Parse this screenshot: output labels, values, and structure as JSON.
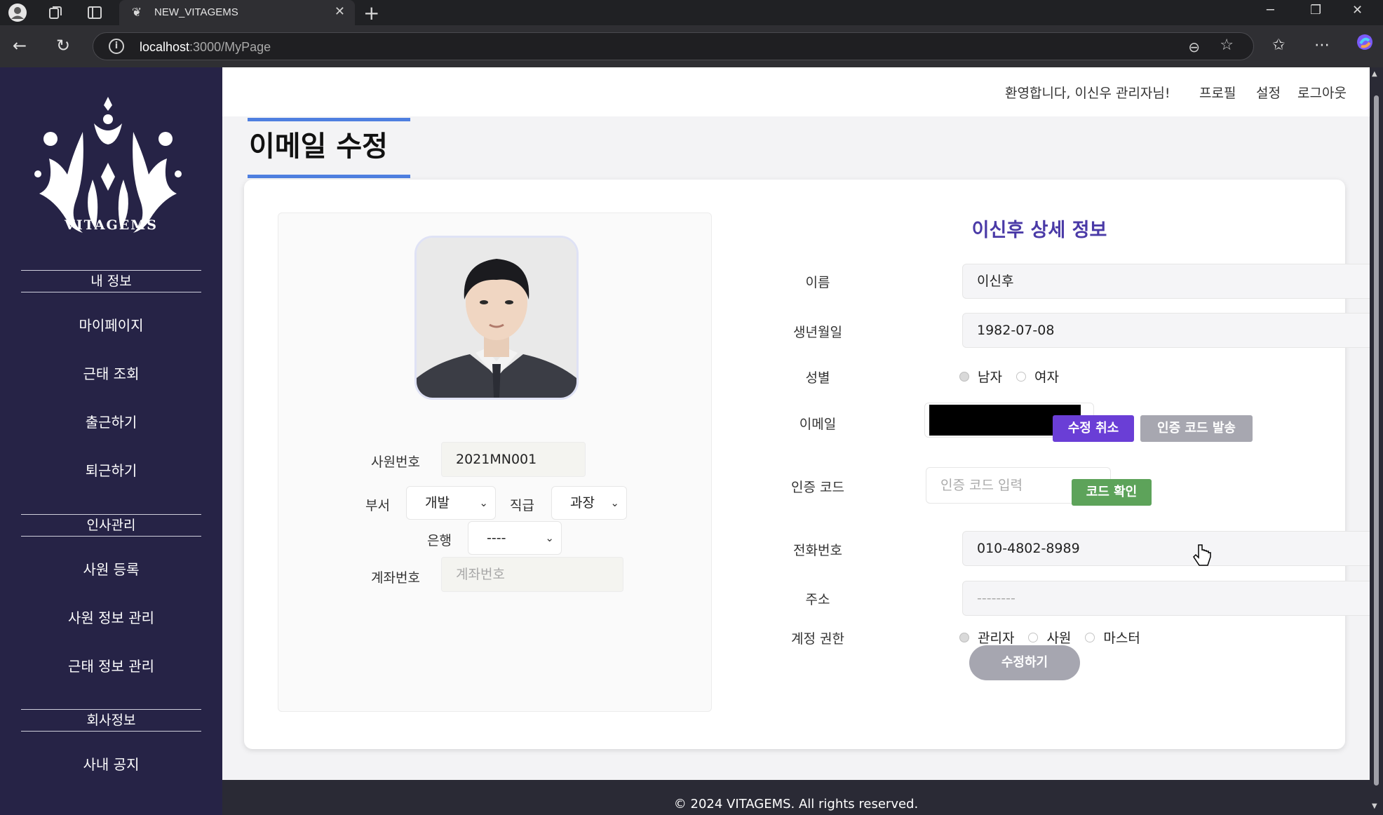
{
  "browser": {
    "tab_title": "NEW_VITAGEMS",
    "url_host": "localhost",
    "url_path": ":3000/MyPage"
  },
  "sidebar": {
    "logo_text": "VITAGEMS",
    "sections": [
      {
        "title": "내 정보",
        "items": [
          "마이페이지",
          "근태 조회",
          "출근하기",
          "퇴근하기"
        ]
      },
      {
        "title": "인사관리",
        "items": [
          "사원 등록",
          "사원 정보 관리",
          "근태 정보 관리"
        ]
      },
      {
        "title": "회사정보",
        "items": [
          "사내 공지"
        ]
      }
    ]
  },
  "topbar": {
    "welcome": "환영합니다, 이신우 관리자님!",
    "profile": "프로필",
    "settings": "설정",
    "logout": "로그아웃"
  },
  "page_title": "이메일 수정",
  "left_panel": {
    "employee_no_label": "사원번호",
    "employee_no": "2021MN001",
    "dept_label": "부서",
    "dept": "개발",
    "rank_label": "직급",
    "rank": "과장",
    "bank_label": "은행",
    "bank": "----",
    "account_label": "계좌번호",
    "account_placeholder": "계좌번호"
  },
  "detail": {
    "title": "이신후 상세 정보",
    "name_label": "이름",
    "name": "이신후",
    "birth_label": "생년월일",
    "birth": "1982-07-08",
    "gender_label": "성별",
    "gender_options": [
      "남자",
      "여자"
    ],
    "gender_selected": "남자",
    "email_label": "이메일",
    "cancel_edit": "수정 취소",
    "send_code": "인증 코드 발송",
    "code_label": "인증 코드",
    "code_placeholder": "인증 코드 입력",
    "verify_code": "코드 확인",
    "phone_label": "전화번호",
    "phone": "010-4802-8989",
    "address_label": "주소",
    "address_placeholder": "--------",
    "role_label": "계정 권한",
    "role_options": [
      "관리자",
      "사원",
      "마스터"
    ],
    "role_selected": "관리자",
    "submit": "수정하기"
  },
  "footer": "© 2024 VITAGEMS. All rights reserved.",
  "colors": {
    "sidebar_bg": "#262346",
    "accent_blue": "#4e7fe0",
    "title_purple": "#4a3aa7",
    "btn_purple": "#6a3ed6",
    "btn_green": "#5da35a",
    "btn_gray": "#a7a7b0"
  }
}
